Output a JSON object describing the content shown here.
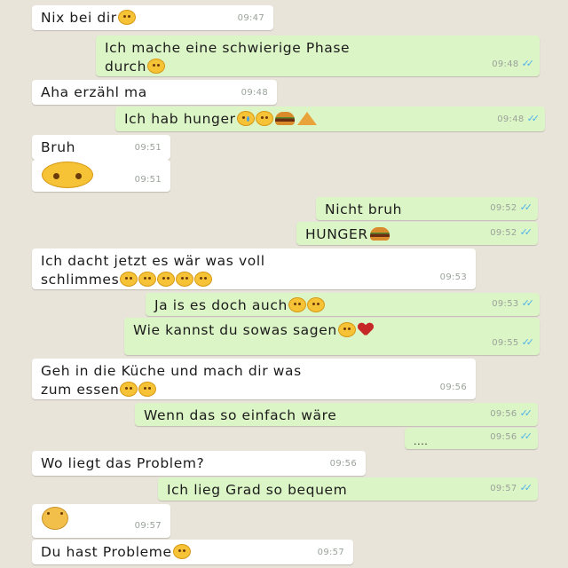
{
  "colors": {
    "background": "#e9e4da",
    "incoming_bubble": "#ffffff",
    "outgoing_bubble": "#dcf5c6",
    "read_ticks": "#4fb3e8",
    "timestamp": "#9aa29a"
  },
  "icons": {
    "read_receipt": "double-check-icon",
    "emoji": "emoji-face-icon",
    "burger": "burger-icon",
    "pizza": "pizza-icon",
    "heart": "broken-heart-icon"
  },
  "messages": [
    {
      "text": "Nix bei dir",
      "time": "09:47"
    },
    {
      "text_line1": "Ich mache eine schwierige Phase",
      "text_line2": "durch",
      "time": "09:48",
      "ticks": "✓✓"
    },
    {
      "text": "Aha erzähl ma",
      "time": "09:48"
    },
    {
      "text": "Ich hab hunger",
      "time": "09:48",
      "ticks": "✓✓"
    },
    {
      "text": "Bruh",
      "time": "09:51"
    },
    {
      "time": "09:51"
    },
    {
      "text": "Nicht bruh",
      "time": "09:52",
      "ticks": "✓✓"
    },
    {
      "text": "HUNGER",
      "time": "09:52",
      "ticks": "✓✓"
    },
    {
      "text_line1": "Ich dacht jetzt es wär was voll",
      "text_line2": "schlimmes",
      "time": "09:53"
    },
    {
      "text": "Ja is es doch auch",
      "time": "09:53",
      "ticks": "✓✓"
    },
    {
      "text": "Wie kannst du sowas sagen",
      "time": "09:55",
      "ticks": "✓✓"
    },
    {
      "text_line1": "Geh in die Küche und mach dir was",
      "text_line2": "zum essen",
      "time": "09:56"
    },
    {
      "text": "Wenn das so einfach wäre",
      "time": "09:56",
      "ticks": "✓✓"
    },
    {
      "text": "....",
      "time": "09:56",
      "ticks": "✓✓"
    },
    {
      "text": "Wo liegt das Problem?",
      "time": "09:56"
    },
    {
      "text": "Ich lieg Grad so bequem",
      "time": "09:57",
      "ticks": "✓✓"
    },
    {
      "time": "09:57"
    },
    {
      "text": "Du hast Probleme",
      "time": "09:57"
    }
  ]
}
